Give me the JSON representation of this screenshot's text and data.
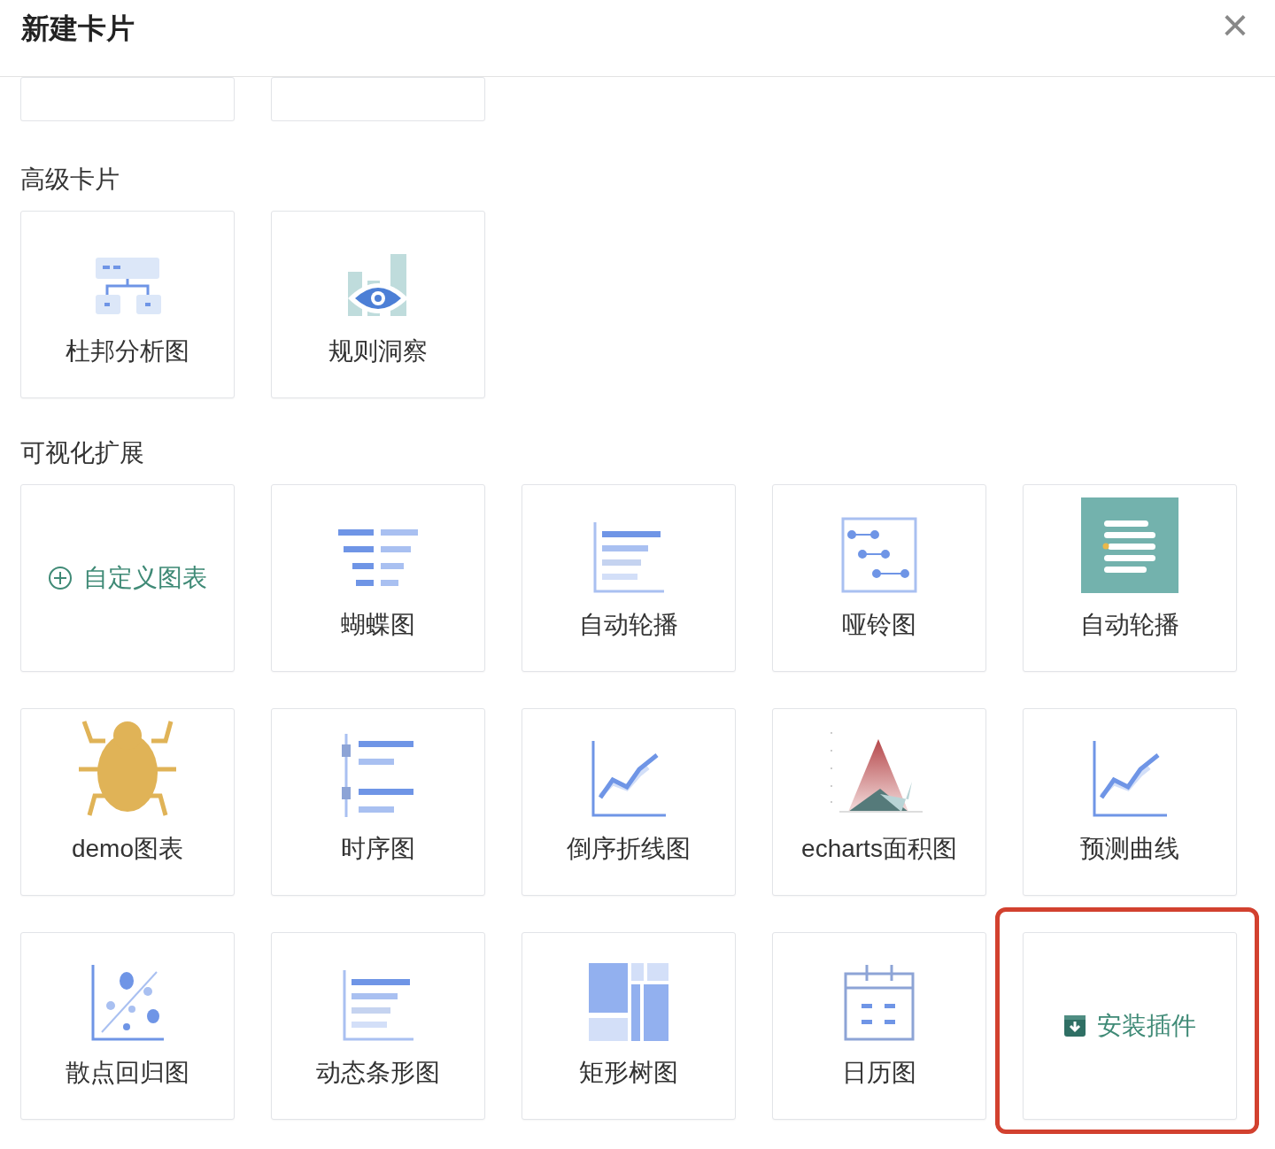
{
  "dialog": {
    "title": "新建卡片",
    "close_label": "×"
  },
  "cut_off_cards": [
    {
      "kind": "card"
    },
    {
      "kind": "card"
    }
  ],
  "sections": [
    {
      "title": "高级卡片",
      "items": [
        {
          "kind": "card",
          "label": "杜邦分析图"
        },
        {
          "kind": "card",
          "label": "规则洞察"
        }
      ]
    },
    {
      "title": "可视化扩展",
      "items": [
        {
          "kind": "add",
          "label": "自定义图表"
        },
        {
          "kind": "card",
          "label": "蝴蝶图"
        },
        {
          "kind": "card",
          "label": "自动轮播"
        },
        {
          "kind": "card",
          "label": "哑铃图"
        },
        {
          "kind": "card",
          "label": "自动轮播"
        },
        {
          "kind": "card",
          "label": "demo图表"
        },
        {
          "kind": "card",
          "label": "时序图"
        },
        {
          "kind": "card",
          "label": "倒序折线图"
        },
        {
          "kind": "card",
          "label": "echarts面积图"
        },
        {
          "kind": "card",
          "label": "预测曲线"
        },
        {
          "kind": "card",
          "label": "散点回归图"
        },
        {
          "kind": "card",
          "label": "动态条形图"
        },
        {
          "kind": "card",
          "label": "矩形树图"
        },
        {
          "kind": "card",
          "label": "日历图"
        },
        {
          "kind": "install",
          "label": "安装插件",
          "highlighted": true
        }
      ]
    }
  ]
}
